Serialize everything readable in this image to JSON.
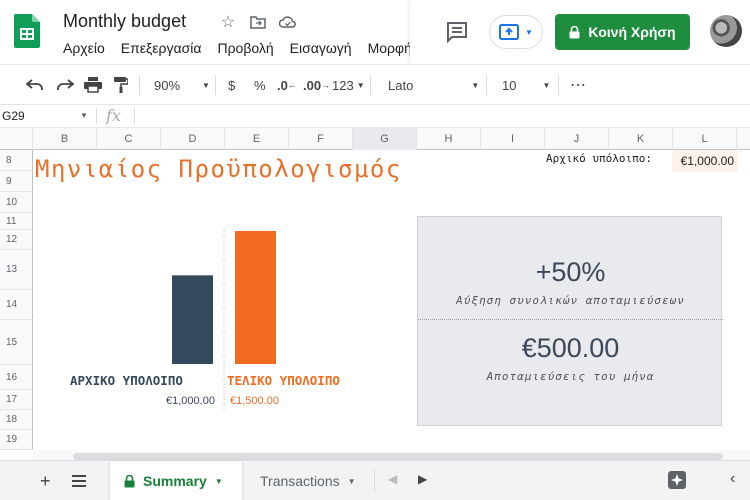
{
  "header": {
    "title": "Monthly budget",
    "menu": [
      "Αρχείο",
      "Επεξεργασία",
      "Προβολή",
      "Εισαγωγή",
      "Μορφή"
    ],
    "share_label": "Κοινή Χρήση"
  },
  "toolbar": {
    "zoom": "90%",
    "currency": "$",
    "percent": "%",
    "decrease_decimals": ".0",
    "increase_decimals": ".00",
    "more_formats": "123",
    "font": "Lato",
    "font_size": "10"
  },
  "formula_bar": {
    "cell_ref": "G29",
    "fx": "fx",
    "value": ""
  },
  "grid": {
    "columns": [
      "B",
      "C",
      "D",
      "E",
      "F",
      "G",
      "H",
      "I",
      "J",
      "K",
      "L"
    ],
    "selected_column": "G",
    "rows": [
      "8",
      "9",
      "10",
      "11",
      "12",
      "13",
      "14",
      "15",
      "16",
      "17",
      "18",
      "19"
    ]
  },
  "sheet": {
    "title": "Μηνιαίος Προϋπολογισμός",
    "initial_label": "Αρχικό υπόλοιπο:",
    "initial_value": "€1,000.00"
  },
  "chart_data": {
    "type": "bar",
    "categories": [
      "ΑΡΧΙΚΟ ΥΠΟΛΟΙΠΟ",
      "ΤΕΛΙΚΟ ΥΠΟΛΟΙΠΟ"
    ],
    "values": [
      1000,
      1500
    ],
    "value_labels": [
      "€1,000.00",
      "€1,500.00"
    ],
    "colors": [
      "#34495e",
      "#f26b21"
    ],
    "title": "",
    "xlabel": "",
    "ylabel": ""
  },
  "scorecard": {
    "metric1_value": "+50%",
    "metric1_label": "Αύξηση συνολικών αποταμιεύσεων",
    "metric2_value": "€500.00",
    "metric2_label": "Αποταμιεύσεις του μήνα"
  },
  "tabs": [
    {
      "label": "Summary"
    },
    {
      "label": "Transactions"
    }
  ],
  "colors": {
    "accent_orange": "#e8702a",
    "dark_slate": "#34495e",
    "share_green": "#1e8e3e",
    "active_tab": "#188038"
  }
}
